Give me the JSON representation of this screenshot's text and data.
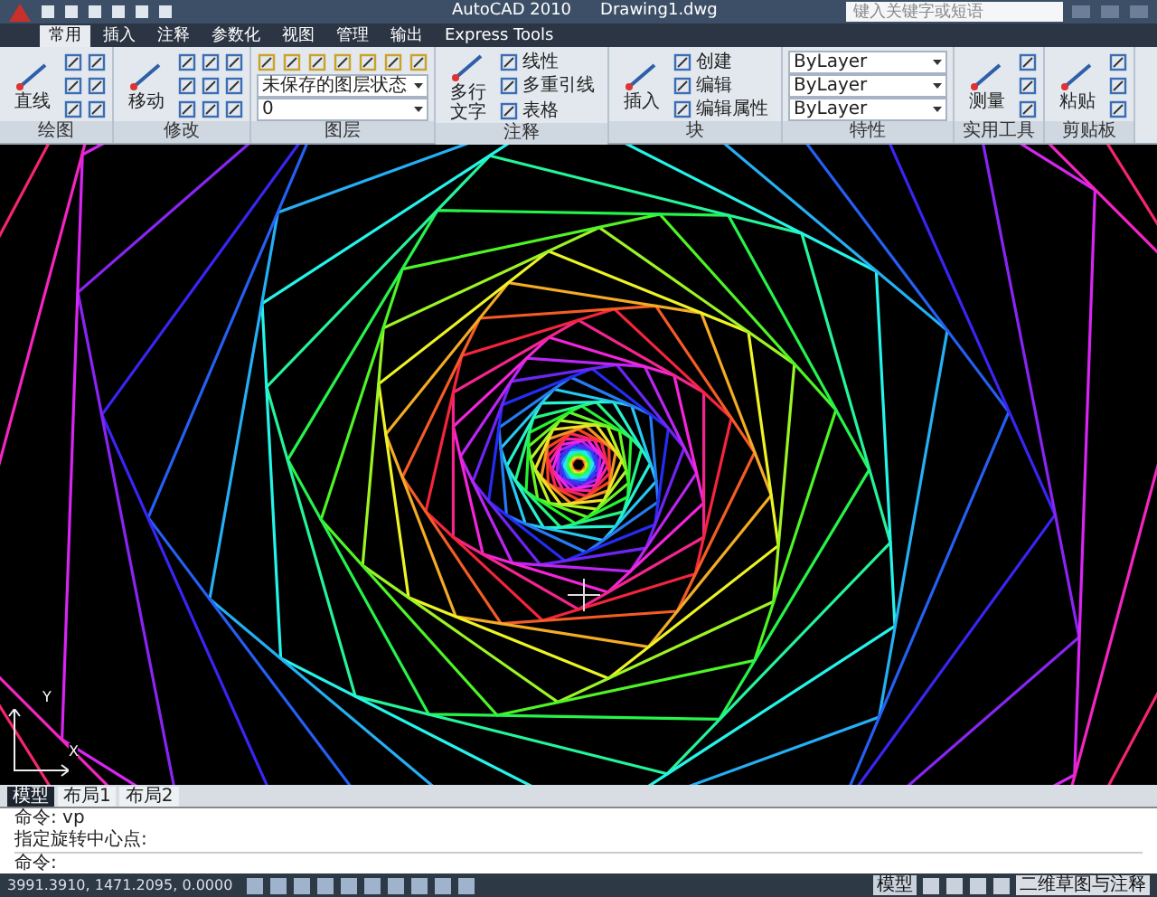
{
  "title_bar": {
    "app": "AutoCAD 2010",
    "document": "Drawing1.dwg",
    "search": {
      "placeholder": "键入关键字或短语"
    }
  },
  "tabs": [
    {
      "label": "常用",
      "selected": true
    },
    {
      "label": "插入",
      "selected": false
    },
    {
      "label": "注释",
      "selected": false
    },
    {
      "label": "参数化",
      "selected": false
    },
    {
      "label": "视图",
      "selected": false
    },
    {
      "label": "管理",
      "selected": false
    },
    {
      "label": "输出",
      "selected": false
    },
    {
      "label": "Express Tools",
      "selected": false
    }
  ],
  "ribbon": [
    {
      "title": "绘图",
      "items": [
        {
          "kind": "large",
          "label": "直线"
        },
        {
          "kind": "tool"
        },
        {
          "kind": "tool"
        },
        {
          "kind": "tool"
        },
        {
          "kind": "tool"
        },
        {
          "kind": "tool"
        },
        {
          "kind": "tool"
        }
      ]
    },
    {
      "title": "修改",
      "items": [
        {
          "kind": "large",
          "label": "移动"
        },
        {
          "kind": "tool"
        },
        {
          "kind": "tool"
        },
        {
          "kind": "tool"
        },
        {
          "kind": "tool"
        },
        {
          "kind": "tool"
        },
        {
          "kind": "tool"
        },
        {
          "kind": "tool"
        },
        {
          "kind": "tool"
        },
        {
          "kind": "tool"
        }
      ]
    },
    {
      "title": "图层",
      "items": [
        {
          "kind": "toolbar"
        },
        {
          "kind": "dropdown",
          "label": "未保存的图层状态"
        },
        {
          "kind": "dropdown",
          "label": "0"
        }
      ]
    },
    {
      "title": "注释",
      "items": [
        {
          "kind": "large",
          "label": "多行文字"
        },
        {
          "kind": "small",
          "label": "线性"
        },
        {
          "kind": "small",
          "label": "多重引线"
        },
        {
          "kind": "small",
          "label": "表格"
        }
      ]
    },
    {
      "title": "块",
      "items": [
        {
          "kind": "large",
          "label": "插入"
        },
        {
          "kind": "small",
          "label": "创建"
        },
        {
          "kind": "small",
          "label": "编辑"
        },
        {
          "kind": "small",
          "label": "编辑属性"
        }
      ]
    },
    {
      "title": "特性",
      "items": [
        {
          "kind": "dropdown",
          "label": "ByLayer"
        },
        {
          "kind": "dropdown",
          "label": "ByLayer"
        },
        {
          "kind": "dropdown",
          "label": "ByLayer"
        }
      ]
    },
    {
      "title": "实用工具",
      "items": [
        {
          "kind": "large",
          "label": "测量"
        },
        {
          "kind": "tool"
        },
        {
          "kind": "tool"
        },
        {
          "kind": "tool"
        }
      ]
    },
    {
      "title": "剪贴板",
      "items": [
        {
          "kind": "large",
          "label": "粘贴"
        },
        {
          "kind": "tool"
        },
        {
          "kind": "tool"
        },
        {
          "kind": "tool"
        }
      ]
    }
  ],
  "ucs": {
    "y": "Y",
    "x": "X"
  },
  "layout_tabs": [
    {
      "label": "模型",
      "selected": true
    },
    {
      "label": "布局1",
      "selected": false
    },
    {
      "label": "布局2",
      "selected": false
    }
  ],
  "command_lines": [
    "命令: vp",
    "指定旋转中心点:"
  ],
  "command_prompt": "命令:",
  "status_bar": {
    "coordinates": "3991.3910, 1471.2095, 0.0000",
    "model": "模型",
    "workspace": "二维草图与注释"
  }
}
